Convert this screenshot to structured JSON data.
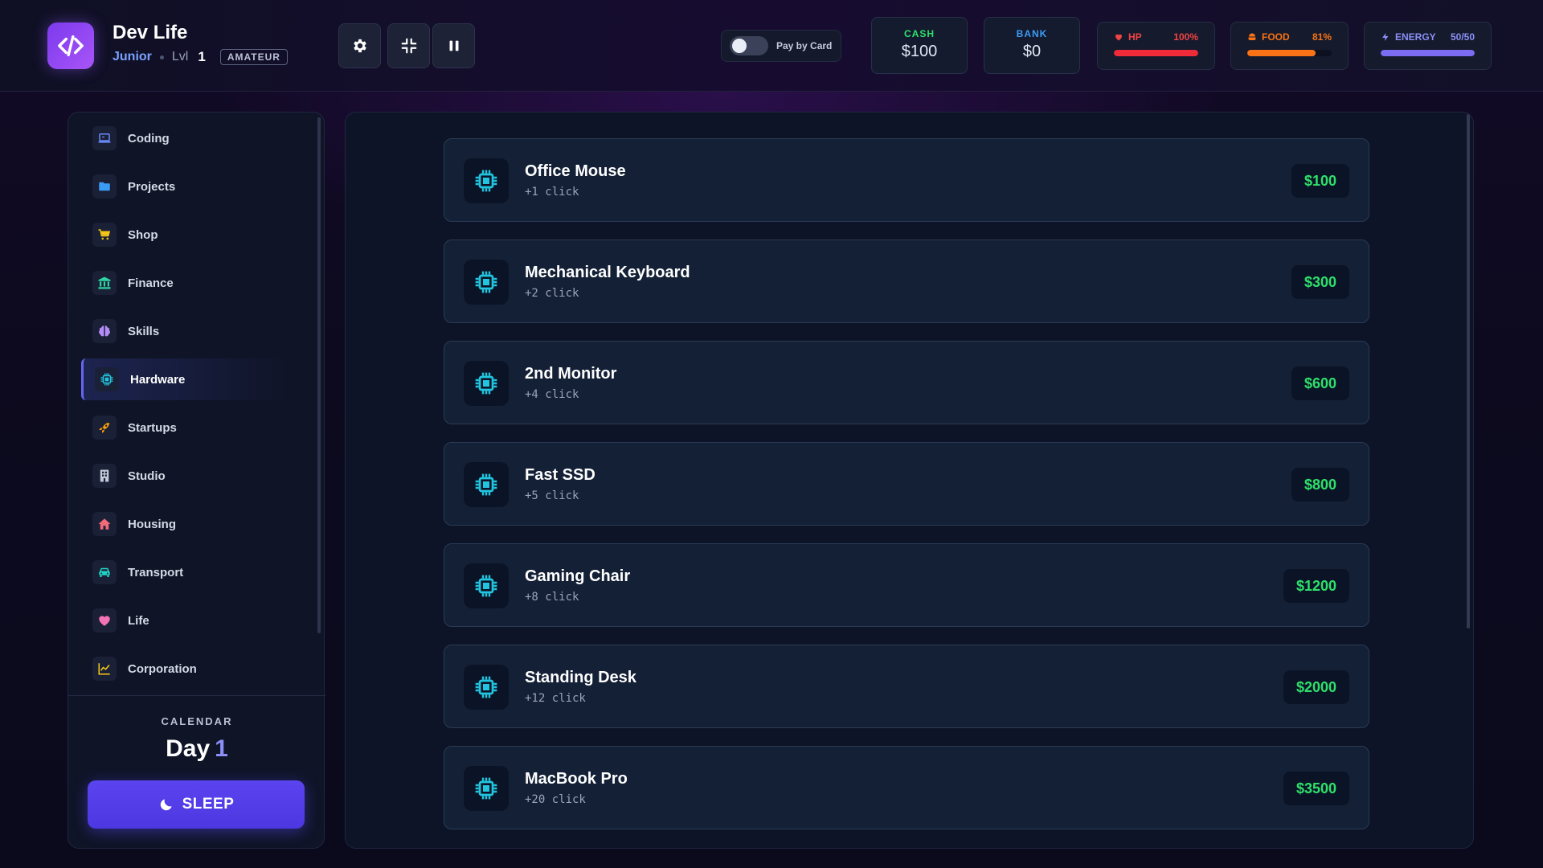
{
  "header": {
    "title": "Dev Life",
    "rank": "Junior",
    "level_label": "Lvl",
    "level_value": "1",
    "tier": "AMATEUR",
    "controls": [
      "gear-icon",
      "compress-icon",
      "pause-icon"
    ],
    "pay_by_card": {
      "label": "Pay by Card",
      "enabled": false
    },
    "cash": {
      "label": "CASH",
      "value": "$100"
    },
    "bank": {
      "label": "BANK",
      "value": "$0"
    },
    "hp": {
      "label": "HP",
      "value": "100%",
      "level": 1.0,
      "color": "#ef2b3a"
    },
    "food": {
      "label": "FOOD",
      "value": "81%",
      "level": 0.81,
      "color": "#f97316"
    },
    "energy": {
      "label": "ENERGY",
      "value": "50/50",
      "level": 1.0,
      "color": "#7c6cf2"
    }
  },
  "sidebar": {
    "items": [
      {
        "label": "Coding",
        "icon": "laptop-icon",
        "color": "#6b8cff"
      },
      {
        "label": "Projects",
        "icon": "folder-icon",
        "color": "#3b9cf5"
      },
      {
        "label": "Shop",
        "icon": "cart-icon",
        "color": "#f5c518"
      },
      {
        "label": "Finance",
        "icon": "bank-icon",
        "color": "#2dd4a4"
      },
      {
        "label": "Skills",
        "icon": "brain-icon",
        "color": "#b48cf7"
      },
      {
        "label": "Hardware",
        "icon": "chip-icon",
        "color": "#22c5e0",
        "active": true
      },
      {
        "label": "Startups",
        "icon": "rocket-icon",
        "color": "#f59e0b"
      },
      {
        "label": "Studio",
        "icon": "building-icon",
        "color": "#c2c9d8"
      },
      {
        "label": "Housing",
        "icon": "house-icon",
        "color": "#f06a7a"
      },
      {
        "label": "Transport",
        "icon": "car-icon",
        "color": "#22d3c5"
      },
      {
        "label": "Life",
        "icon": "heart-icon",
        "color": "#f472b6"
      },
      {
        "label": "Corporation",
        "icon": "chart-line-icon",
        "color": "#facc15"
      }
    ],
    "calendar_label": "CALENDAR",
    "day_label": "Day",
    "day_value": "1",
    "sleep_label": "SLEEP"
  },
  "hardware": {
    "items": [
      {
        "name": "Office Mouse",
        "bonus": "+1 click",
        "price": "$100"
      },
      {
        "name": "Mechanical Keyboard",
        "bonus": "+2 click",
        "price": "$300"
      },
      {
        "name": "2nd Monitor",
        "bonus": "+4 click",
        "price": "$600"
      },
      {
        "name": "Fast SSD",
        "bonus": "+5 click",
        "price": "$800"
      },
      {
        "name": "Gaming Chair",
        "bonus": "+8 click",
        "price": "$1200"
      },
      {
        "name": "Standing Desk",
        "bonus": "+12 click",
        "price": "$2000"
      },
      {
        "name": "MacBook Pro",
        "bonus": "+20 click",
        "price": "$3500"
      }
    ]
  },
  "colors": {
    "accent": "#6366f1",
    "price": "#2ee06b",
    "cash_label": "#2ee06b",
    "bank_label": "#3b9cf5"
  }
}
